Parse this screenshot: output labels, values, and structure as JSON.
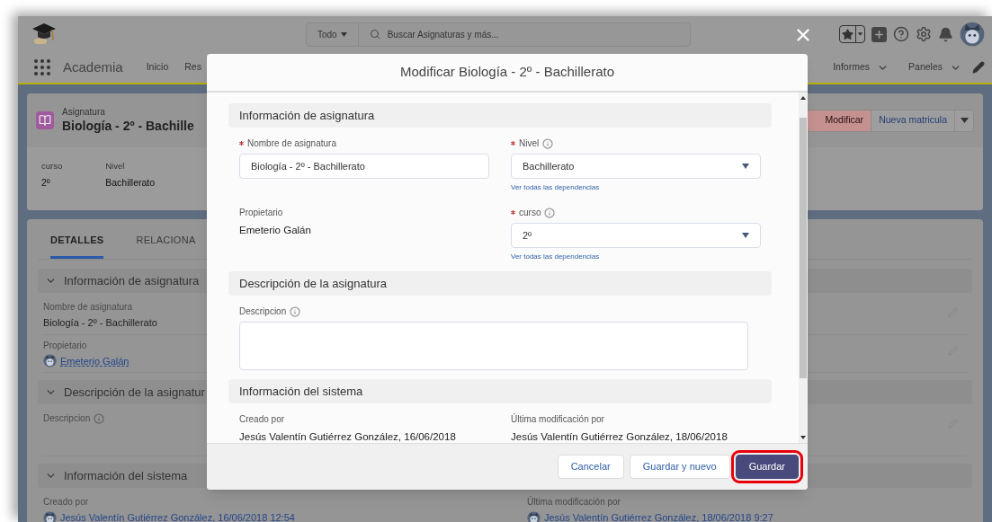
{
  "header": {
    "search_scope": "Todo",
    "search_placeholder": "Buscar Asignaturas y más..."
  },
  "nav": {
    "app_name": "Academia",
    "items": [
      {
        "label": "Inicio"
      },
      {
        "label": "Res"
      }
    ],
    "right_items": [
      {
        "label": "Informes"
      },
      {
        "label": "Paneles"
      }
    ]
  },
  "record": {
    "type": "Asignatura",
    "title": "Biología - 2º - Bachille",
    "actions": [
      {
        "label": "Modificar",
        "hovered": true
      },
      {
        "label": "Nueva matricula",
        "hovered": false
      }
    ],
    "fields": [
      {
        "label": "curso",
        "value": "2º"
      },
      {
        "label": "Nivel",
        "value": "Bachillerato"
      }
    ]
  },
  "detail": {
    "tabs": [
      {
        "label": "DETALLES",
        "selected": true
      },
      {
        "label": "RELACIONA",
        "selected": false
      }
    ],
    "sections": [
      {
        "title": "Información de asignatura",
        "kind": "single",
        "fields": [
          {
            "kind": "text",
            "label": "Nombre de asignatura",
            "value": "Biología - 2º - Bachillerato"
          },
          {
            "kind": "user",
            "label": "Propietario",
            "value": "Emeterio Galán"
          }
        ]
      },
      {
        "title": "Descripción de la asignatur",
        "kind": "single",
        "fields": [
          {
            "kind": "info",
            "label": "Descripcion"
          }
        ]
      },
      {
        "title": "Información del sistema",
        "kind": "two_column",
        "fields": [
          {
            "kind": "user",
            "label": "Creado por",
            "value": "Jesús Valentín Gutiérrez González, 16/06/2018 12:54"
          },
          {
            "kind": "user",
            "label": "Última modificación por",
            "value": "Jesús Valentín Gutiérrez González, 18/06/2018 9:27"
          }
        ]
      }
    ]
  },
  "modal": {
    "title": "Modificar Biología - 2º - Bachillerato",
    "sections": [
      {
        "title": "Información de asignatura",
        "fields": [
          {
            "kind": "input",
            "label": "Nombre de asignatura",
            "required": true,
            "info": false,
            "value": "Biología - 2º - Bachillerato"
          },
          {
            "kind": "select",
            "label": "Nivel",
            "required": true,
            "info": true,
            "value": "Bachillerato",
            "link": "Ver todas las dependencias"
          },
          {
            "kind": "readonly",
            "label": "Propietario",
            "required": false,
            "info": false,
            "value": "Emeterio Galán"
          },
          {
            "kind": "select",
            "label": "curso",
            "required": true,
            "info": true,
            "value": "2º",
            "link": "Ver todas las dependencias"
          }
        ]
      },
      {
        "title": "Descripción de la asignatura",
        "fields": [
          {
            "kind": "textarea",
            "label": "Descripcion",
            "required": false,
            "info": true
          }
        ]
      },
      {
        "title": "Información del sistema",
        "fields": [
          {
            "kind": "readonly",
            "label": "Creado por",
            "required": false,
            "info": false,
            "value": "Jesús Valentín Gutiérrez González, 16/06/2018"
          },
          {
            "kind": "readonly",
            "label": "Última modificación por",
            "required": false,
            "info": false,
            "value": "Jesús Valentín Gutiérrez González, 18/06/2018"
          }
        ]
      }
    ],
    "buttons": [
      {
        "label": "Cancelar",
        "kind": "neutral",
        "highlighted": false
      },
      {
        "label": "Guardar y nuevo",
        "kind": "neutral",
        "highlighted": false
      },
      {
        "label": "Guardar",
        "kind": "brand",
        "highlighted": true
      }
    ]
  }
}
